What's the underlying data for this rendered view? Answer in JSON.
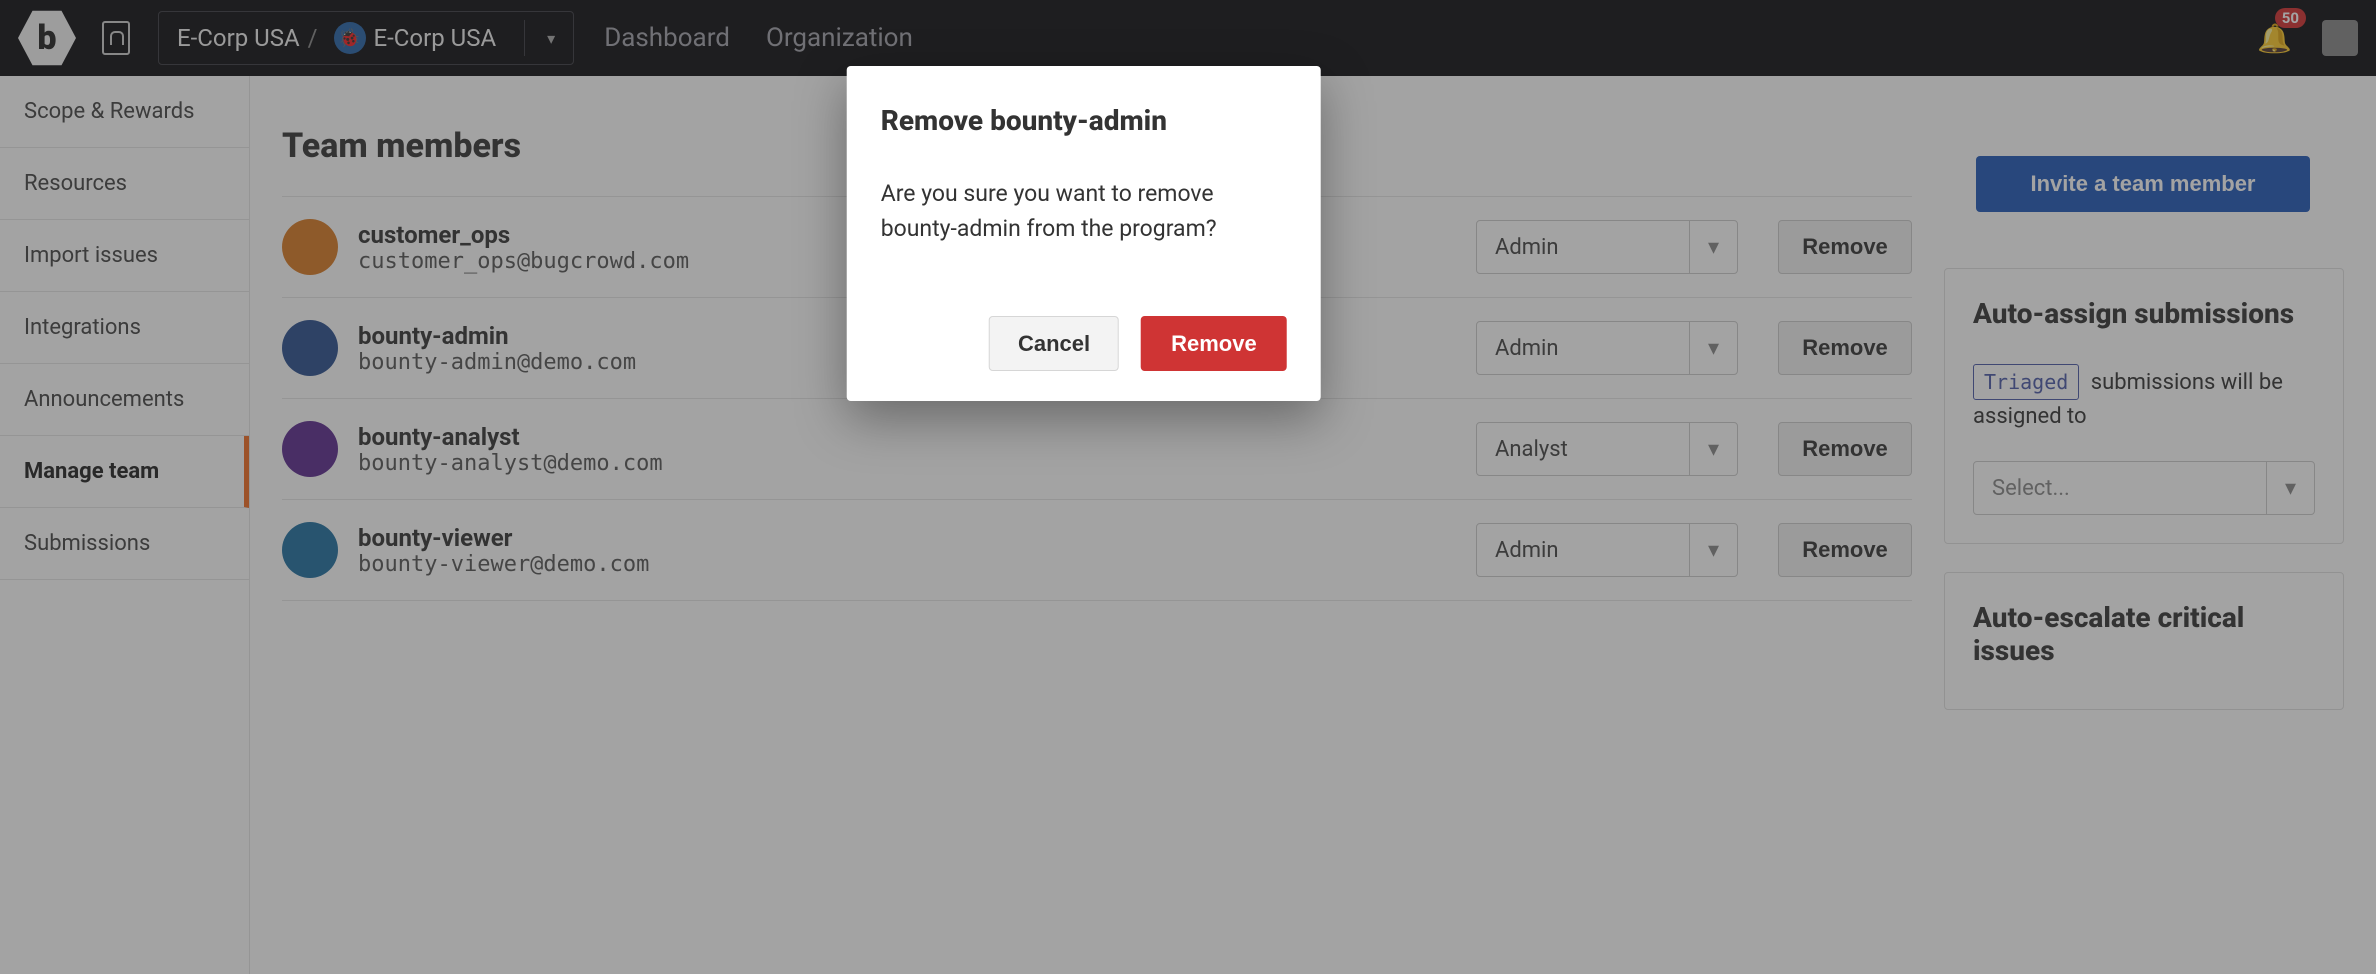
{
  "topbar": {
    "org": "E-Corp USA",
    "program": "E-Corp USA",
    "nav": {
      "dashboard": "Dashboard",
      "organization": "Organization"
    },
    "notification_count": "50"
  },
  "sidebar": {
    "items": [
      {
        "label": "Scope & Rewards"
      },
      {
        "label": "Resources"
      },
      {
        "label": "Import issues"
      },
      {
        "label": "Integrations"
      },
      {
        "label": "Announcements"
      },
      {
        "label": "Manage team"
      },
      {
        "label": "Submissions"
      }
    ],
    "active_index": 5
  },
  "team": {
    "title": "Team members",
    "invite_label": "Invite a team member",
    "remove_label": "Remove",
    "members": [
      {
        "name": "customer_ops",
        "email": "customer_ops@bugcrowd.com",
        "role": "Admin",
        "avatar_color": "#d97a24"
      },
      {
        "name": "bounty-admin",
        "email": "bounty-admin@demo.com",
        "role": "Admin",
        "avatar_color": "#2b4f8f"
      },
      {
        "name": "bounty-analyst",
        "email": "bounty-analyst@demo.com",
        "role": "Analyst",
        "avatar_color": "#5b2b8f"
      },
      {
        "name": "bounty-viewer",
        "email": "bounty-viewer@demo.com",
        "role": "Admin",
        "avatar_color": "#1f6fa0"
      }
    ]
  },
  "auto_assign": {
    "title": "Auto-assign submissions",
    "tag": "Triaged",
    "text": " submissions will be assigned to",
    "placeholder": "Select..."
  },
  "auto_escalate": {
    "title": "Auto-escalate critical issues"
  },
  "modal": {
    "title": "Remove bounty-admin",
    "body": "Are you sure you want to remove bounty-admin from the program?",
    "cancel": "Cancel",
    "remove": "Remove"
  }
}
